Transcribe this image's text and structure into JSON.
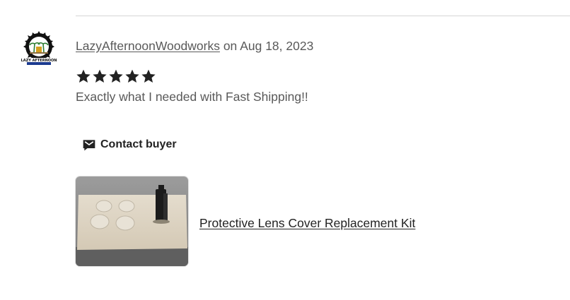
{
  "review": {
    "author": "LazyAfternoonWoodworks",
    "date_prefix": "on",
    "date": "Aug 18, 2023",
    "rating": 5,
    "rating_max": 5,
    "text": "Exactly what I needed with Fast Shipping!!",
    "avatar_icon": "sawblade-logo-icon",
    "avatar_caption": "LAZY AFTERNOON"
  },
  "contact": {
    "label": "Contact buyer",
    "icon": "mail-icon"
  },
  "product": {
    "title": "Protective Lens Cover Replacement Kit"
  },
  "colors": {
    "star": "#222222",
    "text_muted": "#595959",
    "divider": "#d6d6d6"
  }
}
